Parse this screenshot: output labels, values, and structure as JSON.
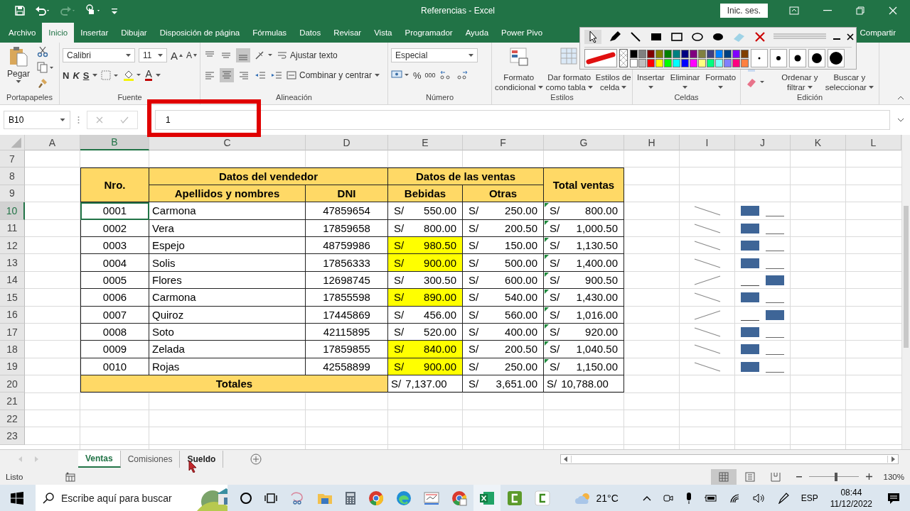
{
  "window": {
    "title": "Referencias  -  Excel",
    "sign_in": "Inic. ses."
  },
  "ribbon_tabs": [
    {
      "label": "Archivo",
      "selected": false
    },
    {
      "label": "Inicio",
      "selected": true
    },
    {
      "label": "Insertar",
      "selected": false
    },
    {
      "label": "Dibujar",
      "selected": false
    },
    {
      "label": "Disposición de página",
      "selected": false
    },
    {
      "label": "Fórmulas",
      "selected": false
    },
    {
      "label": "Datos",
      "selected": false
    },
    {
      "label": "Revisar",
      "selected": false
    },
    {
      "label": "Vista",
      "selected": false
    },
    {
      "label": "Programador",
      "selected": false
    },
    {
      "label": "Ayuda",
      "selected": false
    },
    {
      "label": "Power Pivo",
      "selected": false
    }
  ],
  "share": "Compartir",
  "ribbon": {
    "clipboard": {
      "paste": "Pegar",
      "label": "Portapapeles"
    },
    "font": {
      "name": "Calibri",
      "size": "11",
      "grow": "A",
      "shrink": "A",
      "bold": "N",
      "italic": "K",
      "underline": "S",
      "font_color_button": "A",
      "label": "Fuente"
    },
    "alignment": {
      "wrap": "Ajustar texto",
      "merge": "Combinar y centrar",
      "label": "Alineación"
    },
    "number": {
      "format": "Especial",
      "percent": "%",
      "thousands": "000",
      "label": "Número"
    },
    "styles": {
      "buttons": [
        [
          "Formato",
          "condicional"
        ],
        [
          "Dar formato",
          "como tabla"
        ],
        [
          "Estilos de",
          "celda"
        ]
      ],
      "label": "Estilos"
    },
    "cells": {
      "buttons": [
        "Insertar",
        "Eliminar",
        "Formato"
      ],
      "label": "Celdas"
    },
    "editing": {
      "buttons": [
        [
          "Ordenar y",
          "filtrar"
        ],
        [
          "Buscar y",
          "seleccionar"
        ]
      ],
      "label": "Edición"
    }
  },
  "draw_toolbar": {
    "pen": {
      "color": "#e01010"
    },
    "palette": [
      {
        "color": "#000000"
      },
      {
        "color": "#808080"
      },
      {
        "color": "#800000"
      },
      {
        "color": "#808000"
      },
      {
        "color": "#008000"
      },
      {
        "color": "#008080"
      },
      {
        "color": "#000080"
      },
      {
        "color": "#800080"
      },
      {
        "color": "#808040"
      },
      {
        "color": "#404080"
      },
      {
        "color": "#0080ff"
      },
      {
        "color": "#004080"
      },
      {
        "color": "#8000ff"
      },
      {
        "color": "#804000"
      },
      {
        "color": "#ffffff"
      },
      {
        "color": "#c0c0c0"
      },
      {
        "color": "#ff0000"
      },
      {
        "color": "#ffff00"
      },
      {
        "color": "#00ff00"
      },
      {
        "color": "#00ffff"
      },
      {
        "color": "#0000ff"
      },
      {
        "color": "#ff00ff"
      },
      {
        "color": "#ffff80"
      },
      {
        "color": "#00ff80"
      },
      {
        "color": "#80ffff"
      },
      {
        "color": "#8080ff"
      },
      {
        "color": "#ff0080"
      },
      {
        "color": "#ff8040"
      }
    ]
  },
  "formula_bar": {
    "name_box": "B10",
    "formula": "1"
  },
  "columns": [
    {
      "label": "A",
      "selected": false
    },
    {
      "label": "B",
      "selected": true
    },
    {
      "label": "C",
      "selected": false
    },
    {
      "label": "D",
      "selected": false
    },
    {
      "label": "E",
      "selected": false
    },
    {
      "label": "F",
      "selected": false
    },
    {
      "label": "G",
      "selected": false
    },
    {
      "label": "H",
      "selected": false
    },
    {
      "label": "I",
      "selected": false
    },
    {
      "label": "J",
      "selected": false
    },
    {
      "label": "K",
      "selected": false
    },
    {
      "label": "L",
      "selected": false
    }
  ],
  "row_headers": [
    {
      "label": "7",
      "selected": false
    },
    {
      "label": "8",
      "selected": false
    },
    {
      "label": "9",
      "selected": false
    },
    {
      "label": "10",
      "selected": true
    },
    {
      "label": "11",
      "selected": false
    },
    {
      "label": "12",
      "selected": false
    },
    {
      "label": "13",
      "selected": false
    },
    {
      "label": "14",
      "selected": false
    },
    {
      "label": "15",
      "selected": false
    },
    {
      "label": "16",
      "selected": false
    },
    {
      "label": "17",
      "selected": false
    },
    {
      "label": "18",
      "selected": false
    },
    {
      "label": "19",
      "selected": false
    },
    {
      "label": "20",
      "selected": false
    },
    {
      "label": "21",
      "selected": false
    },
    {
      "label": "22",
      "selected": false
    },
    {
      "label": "23",
      "selected": false
    }
  ],
  "table": {
    "headers": {
      "nro": "Nro.",
      "seller_group": "Datos del vendedor",
      "name": "Apellidos y nombres",
      "dni": "DNI",
      "sales_group": "Datos de las ventas",
      "drinks": "Bebidas",
      "others": "Otras",
      "total": "Total ventas"
    },
    "rows": [
      {
        "nro": "0001",
        "name": "Carmona",
        "dni": "47859654",
        "drinks": {
          "currency": "S/",
          "amount": "550.00",
          "highlighted": false
        },
        "others": {
          "currency": "S/",
          "amount": "250.00"
        },
        "total": {
          "currency": "S/",
          "amount": "800.00"
        },
        "selected": true
      },
      {
        "nro": "0002",
        "name": "Vera",
        "dni": "17859658",
        "drinks": {
          "currency": "S/",
          "amount": "800.00",
          "highlighted": false
        },
        "others": {
          "currency": "S/",
          "amount": "200.50"
        },
        "total": {
          "currency": "S/",
          "amount": "1,000.50"
        },
        "selected": false
      },
      {
        "nro": "0003",
        "name": "Espejo",
        "dni": "48759986",
        "drinks": {
          "currency": "S/",
          "amount": "980.50",
          "highlighted": true
        },
        "others": {
          "currency": "S/",
          "amount": "150.00"
        },
        "total": {
          "currency": "S/",
          "amount": "1,130.50"
        },
        "selected": false
      },
      {
        "nro": "0004",
        "name": "Solis",
        "dni": "17856333",
        "drinks": {
          "currency": "S/",
          "amount": "900.00",
          "highlighted": true
        },
        "others": {
          "currency": "S/",
          "amount": "500.00"
        },
        "total": {
          "currency": "S/",
          "amount": "1,400.00"
        },
        "selected": false
      },
      {
        "nro": "0005",
        "name": "Flores",
        "dni": "12698745",
        "drinks": {
          "currency": "S/",
          "amount": "300.50",
          "highlighted": false
        },
        "others": {
          "currency": "S/",
          "amount": "600.00"
        },
        "total": {
          "currency": "S/",
          "amount": "900.50"
        },
        "selected": false
      },
      {
        "nro": "0006",
        "name": "Carmona",
        "dni": "17855598",
        "drinks": {
          "currency": "S/",
          "amount": "890.00",
          "highlighted": true
        },
        "others": {
          "currency": "S/",
          "amount": "540.00"
        },
        "total": {
          "currency": "S/",
          "amount": "1,430.00"
        },
        "selected": false
      },
      {
        "nro": "0007",
        "name": "Quiroz",
        "dni": "17445869",
        "drinks": {
          "currency": "S/",
          "amount": "456.00",
          "highlighted": false
        },
        "others": {
          "currency": "S/",
          "amount": "560.00"
        },
        "total": {
          "currency": "S/",
          "amount": "1,016.00"
        },
        "selected": false
      },
      {
        "nro": "0008",
        "name": "Soto",
        "dni": "42115895",
        "drinks": {
          "currency": "S/",
          "amount": "520.00",
          "highlighted": false
        },
        "others": {
          "currency": "S/",
          "amount": "400.00"
        },
        "total": {
          "currency": "S/",
          "amount": "920.00"
        },
        "selected": false
      },
      {
        "nro": "0009",
        "name": "Zelada",
        "dni": "17859855",
        "drinks": {
          "currency": "S/",
          "amount": "840.00",
          "highlighted": true
        },
        "others": {
          "currency": "S/",
          "amount": "200.50"
        },
        "total": {
          "currency": "S/",
          "amount": "1,040.50"
        },
        "selected": false
      },
      {
        "nro": "0010",
        "name": "Rojas",
        "dni": "42558899",
        "drinks": {
          "currency": "S/",
          "amount": "900.00",
          "highlighted": true
        },
        "others": {
          "currency": "S/",
          "amount": "250.00"
        },
        "total": {
          "currency": "S/",
          "amount": "1,150.00"
        },
        "selected": false
      }
    ],
    "totals": {
      "label": "Totales",
      "drinks": {
        "currency": "S/",
        "amount": "7,137.00"
      },
      "others": {
        "currency": "S/",
        "amount": "3,651.00"
      },
      "total": {
        "currency": "S/",
        "amount": "10,788.00"
      }
    }
  },
  "sheet_tabs": [
    {
      "label": "Ventas",
      "selected": true,
      "hovered": false
    },
    {
      "label": "Comisiones",
      "selected": false,
      "hovered": false
    },
    {
      "label": "Sueldo",
      "selected": false,
      "hovered": true
    }
  ],
  "status_bar": {
    "status": "Listo",
    "zoom": "130%",
    "zoom_slider": {
      "level": 0.55
    }
  },
  "taskbar": {
    "search": {
      "placeholder": "Escribe aquí para buscar"
    },
    "weather": "21°C",
    "language": "ESP",
    "time": "08:44",
    "date": "11/12/2022"
  }
}
